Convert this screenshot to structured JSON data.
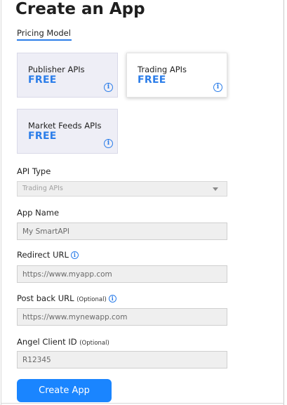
{
  "page": {
    "title": "Create an App"
  },
  "tabs": {
    "pricing_model": "Pricing Model"
  },
  "pricing_cards": [
    {
      "name": "Publisher APIs",
      "price": "FREE",
      "selected": false
    },
    {
      "name": "Trading APIs",
      "price": "FREE",
      "selected": true
    },
    {
      "name": "Market Feeds APIs",
      "price": "FREE",
      "selected": false
    }
  ],
  "form": {
    "api_type": {
      "label": "API Type",
      "value": "Trading APIs"
    },
    "app_name": {
      "label": "App Name",
      "placeholder": "My SmartAPI"
    },
    "redirect_url": {
      "label": "Redirect URL",
      "placeholder": "https://www.myapp.com"
    },
    "postback_url": {
      "label": "Post back URL",
      "optional": "(Optional)",
      "placeholder": "https://www.mynewapp.com"
    },
    "angel_client_id": {
      "label": "Angel Client ID",
      "optional": "(Optional)",
      "placeholder": "R12345"
    }
  },
  "buttons": {
    "create_app": "Create App"
  },
  "icons": {
    "info": "info-icon",
    "dropdown": "chevron-down-icon"
  },
  "colors": {
    "accent": "#1a85ff",
    "price": "#2b7de9",
    "card_bg": "#eeeef6"
  }
}
